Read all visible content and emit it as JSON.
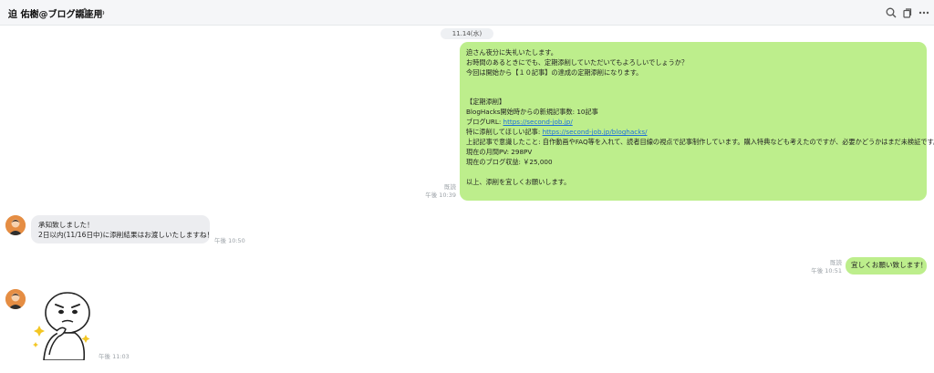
{
  "header": {
    "title": "迫 佑樹@ブログ講座用",
    "icons": [
      "home-icon",
      "speaker-icon",
      "search-icon",
      "copy-icon",
      "more-icon"
    ]
  },
  "date_separator": "11.14(水)",
  "messages": [
    {
      "side": "right",
      "lines": [
        "迫さん夜分に失礼いたします。",
        "お時間のあるときにでも、定期添削していただいてもよろしいでしょうか？",
        "今回は開始から【１０記事】の達成の定期添削になります。",
        "",
        "",
        "【定期添削】",
        "BlogHacks開始時からの新規記事数: 10記事",
        "",
        "",
        "上記記事で意識したこと: 自作動画やFAQ等を入れて、読者目線の視点で記事制作しています。購入特典なども考えたのですが、必要かどうかはまだ未検証です。",
        "現在の月間PV: 298PV",
        "現在のブログ収益: ￥25,000",
        "",
        "以上、添削を宜しくお願いします。"
      ],
      "blog_url_label": "ブログURL: ",
      "blog_url": "https://second-job.jp/",
      "article_label": "特に添削してほしい記事: ",
      "article_url": "https://second-job.jp/bloghacks/",
      "read": "既読",
      "time": "午後 10:39"
    },
    {
      "side": "left",
      "lines": [
        "承知致しました！",
        "2日以内(11/16日中)に添削結果はお渡しいたしますね！"
      ],
      "time": "午後 10:50"
    },
    {
      "side": "right",
      "text": "宜しくお願い致します！",
      "read": "既読",
      "time": "午後 10:51"
    },
    {
      "side": "left",
      "sticker": "thinking-man-sticker",
      "time": "午後 11:03"
    }
  ],
  "colors": {
    "bubble_green": "#bdee8c",
    "bubble_gray": "#ecedf0",
    "link": "#1e6fd9",
    "header_bg": "#f5f6f8"
  }
}
